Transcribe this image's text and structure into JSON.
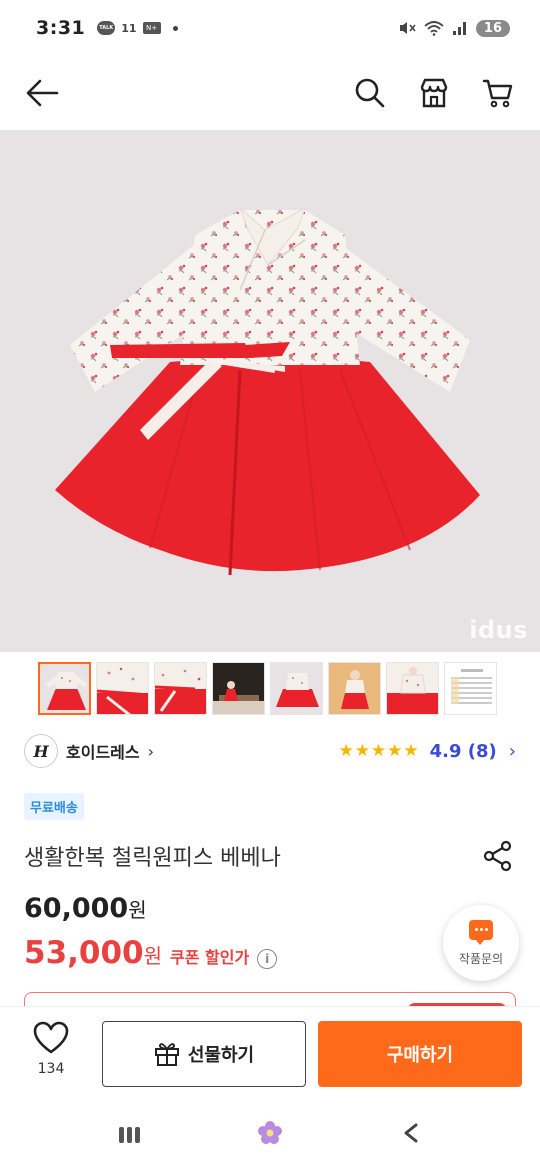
{
  "status_bar": {
    "time": "3:31",
    "talk_label": "TALK",
    "eleven_label": "11",
    "n_label": "N+",
    "battery": "16"
  },
  "icons": {
    "back": "arrow-left-icon",
    "search": "search-icon",
    "shop": "shop-icon",
    "cart": "cart-icon",
    "share": "share-icon",
    "heart": "heart-icon",
    "gift": "gift-icon",
    "chat": "chat-icon"
  },
  "hero": {
    "watermark": "idus"
  },
  "thumbnails": {
    "count": 8,
    "selected_index": 0
  },
  "seller": {
    "avatar_letter": "H",
    "name": "호이드레스",
    "chevron": "›",
    "stars": "★★★★★",
    "rating": "4.9 (8)",
    "rating_chevron": "›"
  },
  "badge": "무료배송",
  "product": {
    "title": "생활한복 철릭원피스 베베나",
    "original_price": "60,000",
    "original_unit": "원",
    "sale_price": "53,000",
    "sale_unit": "원",
    "coupon_text": "쿠폰 할인가",
    "info_symbol": "i"
  },
  "inquiry": {
    "label": "작품문의"
  },
  "action_bar": {
    "like_count": "134",
    "gift_label": "선물하기",
    "buy_label": "구매하기"
  },
  "colors": {
    "accent": "#ff6a1a",
    "sale_red": "#e8413f",
    "rating_blue": "#3b4bd8",
    "star_yellow": "#f7b500",
    "badge_blue": "#2b8de0",
    "badge_bg": "#e8f4fd"
  }
}
